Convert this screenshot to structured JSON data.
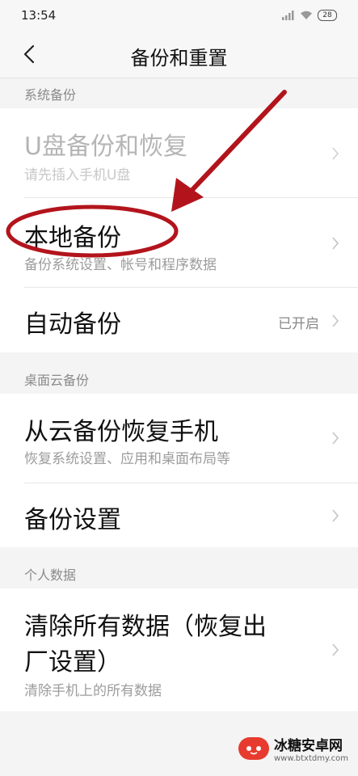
{
  "status_bar": {
    "time": "13:54",
    "battery": "28"
  },
  "header": {
    "title": "备份和重置"
  },
  "sections": [
    {
      "header": "系统备份",
      "items": [
        {
          "title": "U盘备份和恢复",
          "subtitle": "请先插入手机U盘",
          "disabled": true
        },
        {
          "title": "本地备份",
          "subtitle": "备份系统设置、帐号和程序数据",
          "highlighted": true
        },
        {
          "title": "自动备份",
          "status": "已开启"
        }
      ]
    },
    {
      "header": "桌面云备份",
      "items": [
        {
          "title": "从云备份恢复手机",
          "subtitle": "恢复系统设置、应用和桌面布局等"
        },
        {
          "title": "备份设置"
        }
      ]
    },
    {
      "header": "个人数据",
      "items": [
        {
          "title_line1": "清除所有数据（恢复出",
          "title_line2": "厂设置）",
          "subtitle": "清除手机上的所有数据"
        }
      ]
    }
  ],
  "watermark": {
    "name": "冰糖安卓网",
    "url": "www.btxtdmy.com"
  },
  "colors": {
    "annotation_red": "#b3141c",
    "background": "#f4f4f4",
    "card": "#ffffff",
    "secondary_text": "#9c9c9c"
  },
  "icons": [
    "back-icon",
    "signal-icon",
    "wifi-icon",
    "battery-icon",
    "chevron-right-icon"
  ]
}
